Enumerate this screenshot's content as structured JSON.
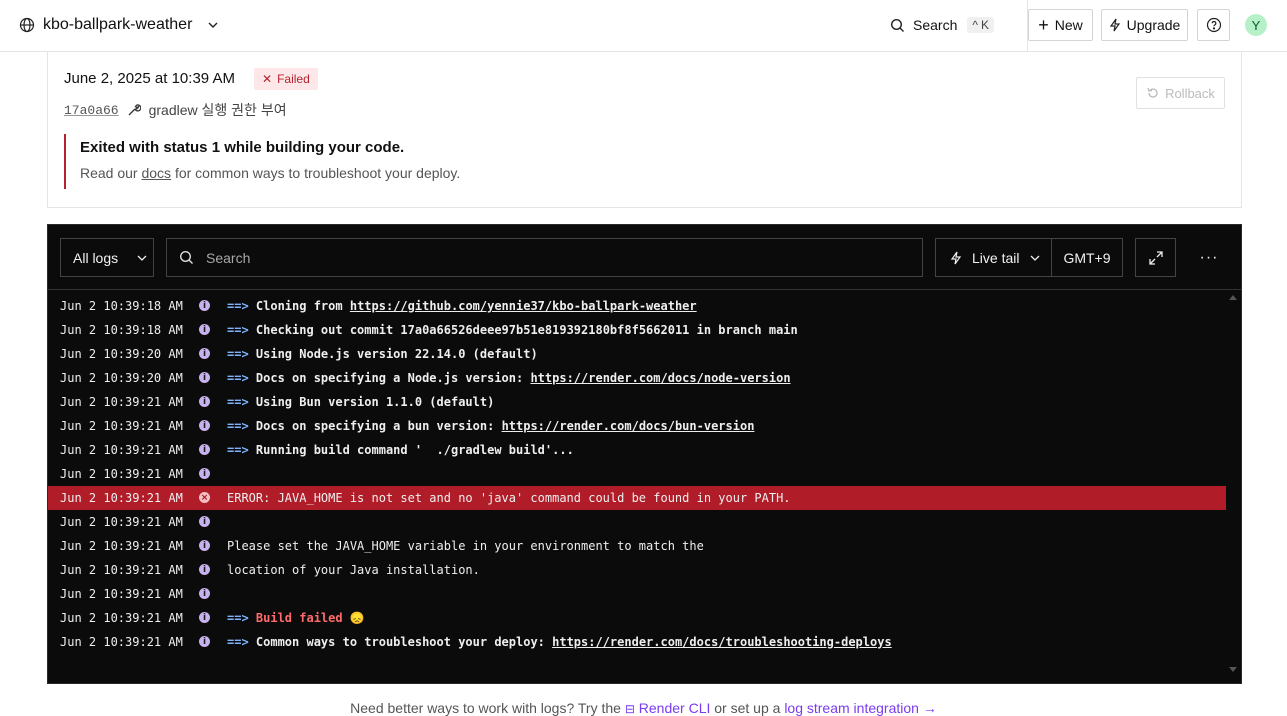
{
  "header": {
    "project_name": "kbo-ballpark-weather",
    "search_label": "Search",
    "search_shortcut": "K",
    "new_label": "New",
    "upgrade_label": "Upgrade",
    "avatar_initial": "Y"
  },
  "deploy": {
    "datetime": "June 2, 2025 at 10:39 AM",
    "status": "Failed",
    "commit_hash": "17a0a66",
    "commit_message": "gradlew 실행 권한 부여",
    "rollback_label": "Rollback",
    "error_title": "Exited with status 1 while building your code.",
    "error_desc_prefix": "Read our ",
    "error_desc_link": "docs",
    "error_desc_suffix": " for common ways to troubleshoot your deploy.",
    "colors": {
      "failed_text": "#b4232c",
      "failed_bg": "#fde7e9"
    }
  },
  "logs": {
    "filter_label": "All logs",
    "search_placeholder": "Search",
    "live_tail_label": "Live tail",
    "timezone": "GMT+9",
    "more_label": "···",
    "lines": [
      {
        "ts": "Jun 2 10:39:18 AM",
        "level": "info",
        "arrow": "==>",
        "text": " Cloning from ",
        "link": "https://github.com/yennie37/kbo-ballpark-weather"
      },
      {
        "ts": "Jun 2 10:39:18 AM",
        "level": "info",
        "arrow": "==>",
        "text": " Checking out commit 17a0a66526deee97b51e819392180bf8f5662011 in branch main",
        "link": ""
      },
      {
        "ts": "Jun 2 10:39:20 AM",
        "level": "info",
        "arrow": "==>",
        "text": " Using Node.js version 22.14.0 (default)",
        "link": ""
      },
      {
        "ts": "Jun 2 10:39:20 AM",
        "level": "info",
        "arrow": "==>",
        "text": " Docs on specifying a Node.js version: ",
        "link": "https://render.com/docs/node-version"
      },
      {
        "ts": "Jun 2 10:39:21 AM",
        "level": "info",
        "arrow": "==>",
        "text": " Using Bun version 1.1.0 (default)",
        "link": ""
      },
      {
        "ts": "Jun 2 10:39:21 AM",
        "level": "info",
        "arrow": "==>",
        "text": " Docs on specifying a bun version: ",
        "link": "https://render.com/docs/bun-version"
      },
      {
        "ts": "Jun 2 10:39:21 AM",
        "level": "info",
        "arrow": "==>",
        "text": " Running build command '  ./gradlew build'...",
        "link": ""
      },
      {
        "ts": "Jun 2 10:39:21 AM",
        "level": "info",
        "arrow": "",
        "text": "",
        "link": ""
      },
      {
        "ts": "Jun 2 10:39:21 AM",
        "level": "error",
        "arrow": "",
        "text": "ERROR: JAVA_HOME is not set and no 'java' command could be found in your PATH.",
        "link": ""
      },
      {
        "ts": "Jun 2 10:39:21 AM",
        "level": "info",
        "arrow": "",
        "text": "",
        "link": ""
      },
      {
        "ts": "Jun 2 10:39:21 AM",
        "level": "info",
        "arrow": "",
        "text": "Please set the JAVA_HOME variable in your environment to match the",
        "link": ""
      },
      {
        "ts": "Jun 2 10:39:21 AM",
        "level": "info",
        "arrow": "",
        "text": "location of your Java installation.",
        "link": ""
      },
      {
        "ts": "Jun 2 10:39:21 AM",
        "level": "info",
        "arrow": "",
        "text": "",
        "link": ""
      },
      {
        "ts": "Jun 2 10:39:21 AM",
        "level": "info",
        "arrow": "==>",
        "text": " Build failed 😞",
        "link": "",
        "failed": true
      },
      {
        "ts": "Jun 2 10:39:21 AM",
        "level": "info",
        "arrow": "==>",
        "text": " Common ways to troubleshoot your deploy: ",
        "link": "https://render.com/docs/troubleshooting-deploys"
      }
    ]
  },
  "footer": {
    "prefix": "Need better ways to work with logs? Try the ",
    "cli_label": "Render CLI",
    "middle": " or set up a ",
    "stream_label": "log stream integration →"
  }
}
